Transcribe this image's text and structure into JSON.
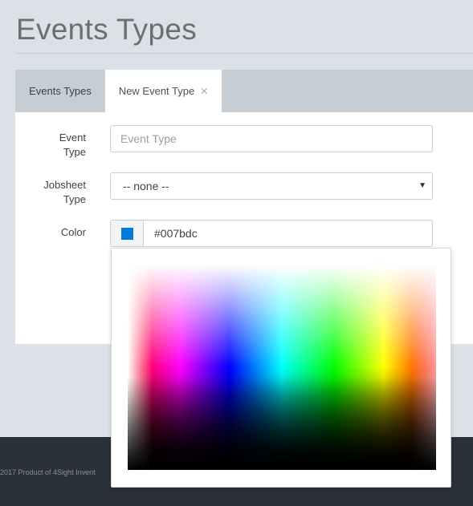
{
  "page": {
    "title": "Events Types"
  },
  "tabs": [
    {
      "label": "Events Types",
      "active": false
    },
    {
      "label": "New Event Type",
      "active": true,
      "close_icon": "close-icon"
    }
  ],
  "form": {
    "event_type": {
      "label": "Event\nType",
      "label_line1": "Event",
      "label_line2": "Type",
      "value": "",
      "placeholder": "Event Type"
    },
    "jobsheet_type": {
      "label_line1": "Jobsheet",
      "label_line2": "Type",
      "selected": "-- none --"
    },
    "color": {
      "label": "Color",
      "value": "#007bdc",
      "swatch_color": "#007bdc"
    }
  },
  "footer": {
    "text": "2017 Product of 4Sight Invent"
  },
  "colors": {
    "background": "#dce1e8",
    "tabbar": "#c5ced5",
    "footer": "#2b3138",
    "accent": "#007bdc"
  }
}
